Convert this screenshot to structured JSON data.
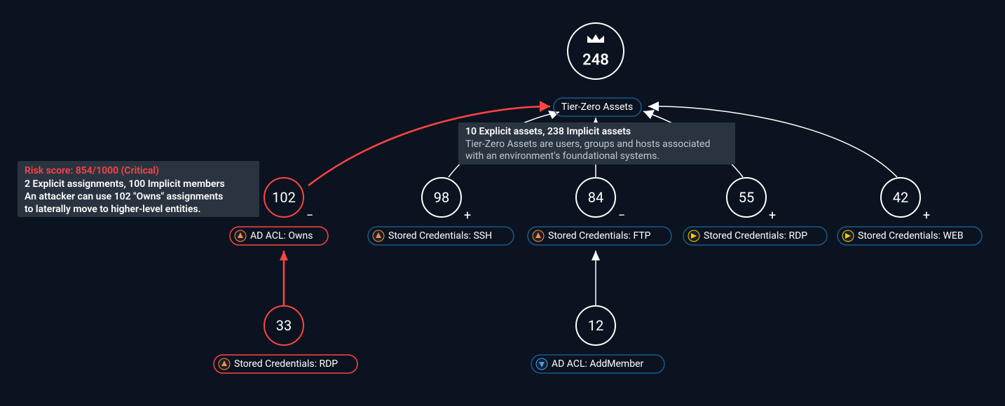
{
  "root": {
    "count": "248",
    "label": "Tier-Zero Assets",
    "tooltip": {
      "title": "10 Explicit assets, 238 Implicit assets",
      "line1": "Tier-Zero Assets are users, groups and hosts associated",
      "line2": "with an environment's foundational systems."
    }
  },
  "mid": {
    "n102": {
      "count": "102",
      "pm": "−",
      "label": "AD ACL: Owns",
      "icon": "triangle",
      "danger": true
    },
    "n98": {
      "count": "98",
      "pm": "+",
      "label": "Stored Credentials: SSH",
      "icon": "triangle",
      "danger": false
    },
    "n84": {
      "count": "84",
      "pm": "−",
      "label": "Stored Credentials: FTP",
      "icon": "triangle",
      "danger": false
    },
    "n55": {
      "count": "55",
      "pm": "+",
      "label": "Stored Credentials: RDP",
      "icon": "play",
      "danger": false
    },
    "n42": {
      "count": "42",
      "pm": "+",
      "label": "Stored Credentials: WEB",
      "icon": "play",
      "danger": false
    }
  },
  "leaf": {
    "n33": {
      "count": "33",
      "label": "Stored Credentials: RDP",
      "icon": "triangle",
      "danger": true
    },
    "n12": {
      "count": "12",
      "label": "AD ACL: AddMember",
      "icon": "triangle-down",
      "danger": false
    }
  },
  "riskTooltip": {
    "title": "Risk score: 854/1000 (Critical)",
    "line1": "2 Explicit assignments, 100 Implicit members",
    "line2": "An attacker can use 102 \"Owns\" assignments",
    "line3": "to laterally move to higher-level entities."
  }
}
